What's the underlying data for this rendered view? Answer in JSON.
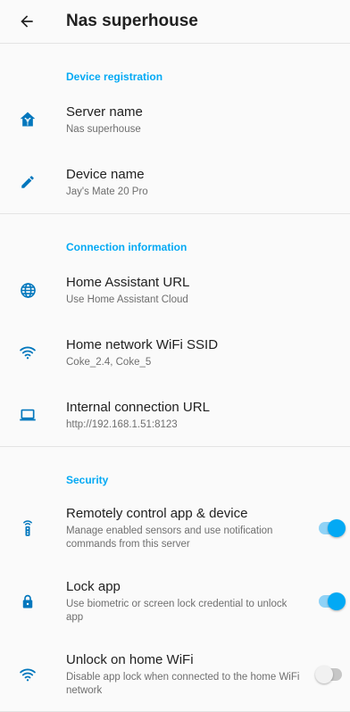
{
  "header": {
    "title": "Nas superhouse"
  },
  "colors": {
    "accent": "#03a9f4",
    "icon": "#0277bd"
  },
  "sections": [
    {
      "title": "Device registration",
      "items": [
        {
          "title": "Server name",
          "subtitle": "Nas superhouse",
          "icon": "home-assistant-icon"
        },
        {
          "title": "Device name",
          "subtitle": "Jay's Mate 20 Pro",
          "icon": "pencil-icon"
        }
      ]
    },
    {
      "title": "Connection information",
      "items": [
        {
          "title": "Home Assistant URL",
          "subtitle": "Use Home Assistant Cloud",
          "icon": "globe-icon"
        },
        {
          "title": "Home network WiFi SSID",
          "subtitle": "Coke_2.4, Coke_5",
          "icon": "wifi-icon"
        },
        {
          "title": "Internal connection URL",
          "subtitle": "http://192.168.1.51:8123",
          "icon": "laptop-icon"
        }
      ]
    },
    {
      "title": "Security",
      "items": [
        {
          "title": "Remotely control app & device",
          "subtitle": "Manage enabled sensors and use notification commands from this server",
          "icon": "remote-icon",
          "toggle": true
        },
        {
          "title": "Lock app",
          "subtitle": "Use biometric or screen lock credential to unlock app",
          "icon": "lock-icon",
          "toggle": true
        },
        {
          "title": "Unlock on home WiFi",
          "subtitle": "Disable app lock when connected to the home WiFi network",
          "icon": "wifi-icon",
          "toggle": false
        }
      ]
    }
  ]
}
